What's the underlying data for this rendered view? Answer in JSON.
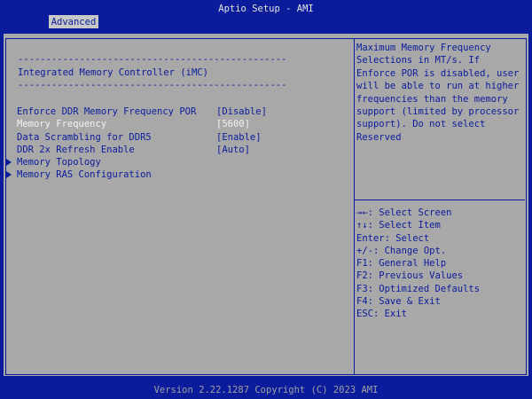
{
  "header": {
    "title": "Aptio Setup - AMI"
  },
  "tabs": [
    {
      "label": "Advanced"
    }
  ],
  "section": {
    "separator": "------------------------------------------------",
    "title": "Integrated Memory Controller (iMC)"
  },
  "settings": [
    {
      "label": "Enforce DDR Memory Frequency POR",
      "value": "[Disable]"
    },
    {
      "label": "Memory Frequency",
      "value": "[5600]"
    },
    {
      "label": "Data Scrambling for DDR5",
      "value": "[Enable]"
    },
    {
      "label": "DDR 2x Refresh Enable",
      "value": "[Auto]"
    }
  ],
  "submenus": [
    {
      "label": "Memory Topology"
    },
    {
      "label": "Memory RAS Configuration"
    }
  ],
  "help": {
    "text": "Maximum Memory Frequency Selections in MT/s. If Enforce POR is disabled, user will be able to run at higher frequencies than the memory support (limited by processor support). Do not select Reserved"
  },
  "keys": [
    "→←: Select Screen",
    "↑↓: Select Item",
    "Enter: Select",
    "+/-: Change Opt.",
    "F1: General Help",
    "F2: Previous Values",
    "F3: Optimized Defaults",
    "F4: Save & Exit",
    "ESC: Exit"
  ],
  "footer": {
    "text": "Version 2.22.1287 Copyright (C) 2023 AMI"
  },
  "colors": {
    "background": "#0a1c9c",
    "panel": "#a8a8a8",
    "highlight": "#f4f4f4"
  }
}
